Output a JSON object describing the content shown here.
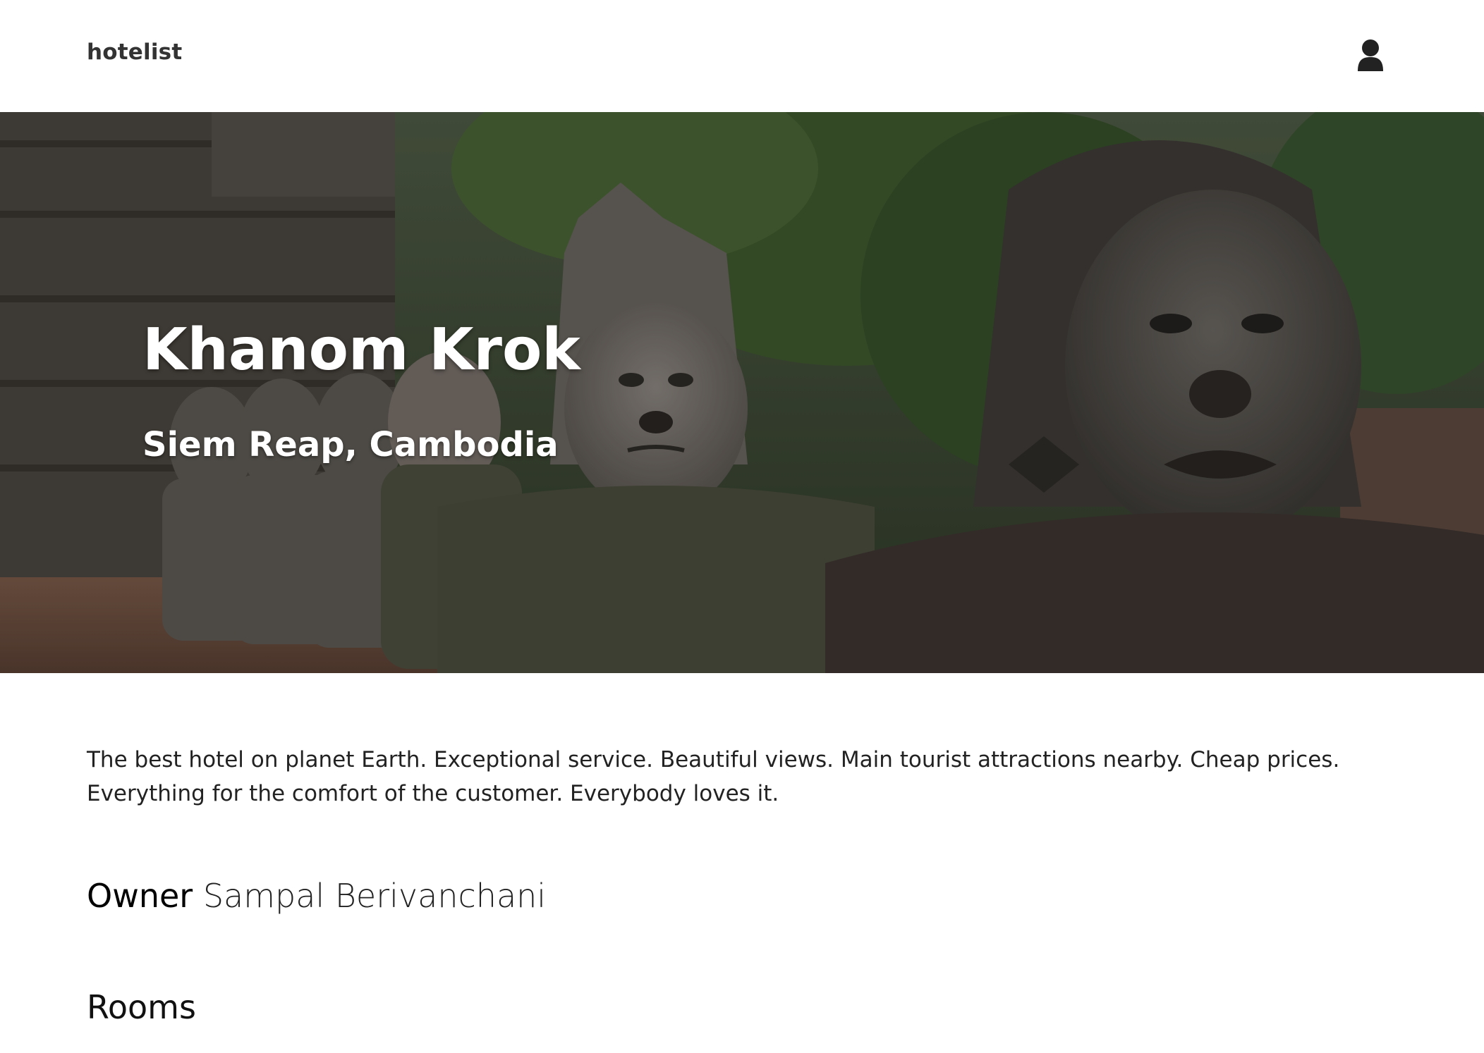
{
  "navbar": {
    "brand": "hotelist",
    "user_icon": "user-icon"
  },
  "hero": {
    "title": "Khanom Krok",
    "subtitle": "Siem Reap, Cambodia",
    "image_icon": "stone-statues-photo"
  },
  "main": {
    "description": "The best hotel on planet Earth. Exceptional service. Beautiful views. Main tourist attractions nearby. Cheap prices. Everything for the comfort of the customer. Everybody loves it.",
    "owner_label": "Owner",
    "owner_name": "Sampal Berivanchani",
    "rooms_heading": "Rooms"
  },
  "colors": {
    "text": "#222222",
    "brand": "#333333",
    "hero_text": "#ffffff",
    "foliage": "#3d5a2c",
    "stone": "#6e6a63"
  }
}
